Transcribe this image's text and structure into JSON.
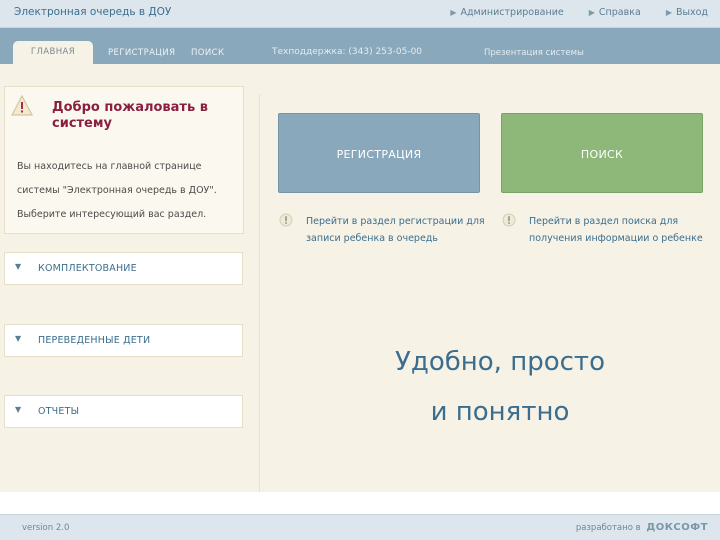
{
  "header": {
    "app_title": "Электронная очередь в ДОУ",
    "links": [
      {
        "label": "Администрирование"
      },
      {
        "label": "Справка"
      },
      {
        "label": "Выход"
      }
    ]
  },
  "nav": {
    "tabs": [
      {
        "label": "ГЛАВНАЯ",
        "active": true
      },
      {
        "label": "РЕГИСТРАЦИЯ",
        "active": false
      },
      {
        "label": "ПОИСК",
        "active": false
      }
    ],
    "support": "Техподдержка: (343) 253-05-00",
    "presentation": "Презентация системы"
  },
  "welcome": {
    "title": "Добро пожаловать в систему",
    "text": "Вы находитесь на главной странице системы \"Электронная очередь в ДОУ\". Выберите интересующий вас раздел."
  },
  "sidebar": {
    "items": [
      {
        "label": "КОМПЛЕКТОВАНИЕ"
      },
      {
        "label": "ПЕРЕВЕДЕННЫЕ ДЕТИ"
      },
      {
        "label": "ОТЧЕТЫ"
      }
    ]
  },
  "main": {
    "buttons": [
      {
        "label": "РЕГИСТРАЦИЯ",
        "hint": "Перейти в раздел регистрации для записи ребенка в очередь",
        "color": "#8aa8bb"
      },
      {
        "label": "ПОИСК",
        "hint": "Перейти в раздел поиска для получения информации о ребенке",
        "color": "#8db87a"
      }
    ],
    "slogan_line1": "Удобно, просто",
    "slogan_line2": "и понятно"
  },
  "footer": {
    "version": "version 2.0",
    "developed_by": "разработано в",
    "brand": "ДОКСОФТ"
  },
  "colors": {
    "accent": "#3b6e8e",
    "welcome_title": "#8b1f3f",
    "content_bg": "#f6f2e6"
  }
}
